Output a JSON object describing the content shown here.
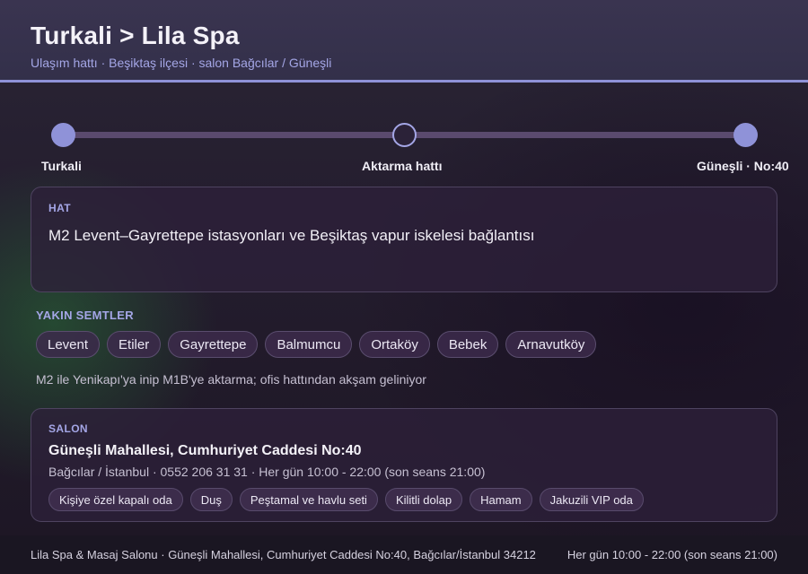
{
  "header": {
    "title": "Turkali > Lila Spa",
    "subtitle": "Ulaşım hattı · Beşiktaş ilçesi · salon Bağcılar / Güneşli"
  },
  "route": {
    "start": "Turkali",
    "middle": "Aktarma hattı",
    "end": "Güneşli · No:40"
  },
  "hat": {
    "label": "HAT",
    "text": "M2 Levent–Gayrettepe istasyonları ve Beşiktaş vapur iskelesi bağlantısı"
  },
  "nearby": {
    "label": "YAKIN SEMTLER",
    "items": [
      "Levent",
      "Etiler",
      "Gayrettepe",
      "Balmumcu",
      "Ortaköy",
      "Bebek",
      "Arnavutköy"
    ],
    "note": "M2 ile Yenikapı'ya inip M1B'ye aktarma; ofis hattından akşam geliniyor"
  },
  "salon": {
    "label": "SALON",
    "name": "Güneşli Mahallesi, Cumhuriyet Caddesi No:40",
    "meta": "Bağcılar / İstanbul · 0552 206 31 31 · Her gün 10:00 - 22:00 (son seans 21:00)",
    "amenities": [
      "Kişiye özel kapalı oda",
      "Duş",
      "Peştamal ve havlu seti",
      "Kilitli dolap",
      "Hamam",
      "Jakuzili VIP oda"
    ]
  },
  "footer": {
    "left": "Lila Spa & Masaj Salonu · Güneşli Mahallesi, Cumhuriyet Caddesi No:40, Bağcılar/İstanbul 34212",
    "right": "Her gün 10:00 - 22:00 (son seans 21:00)"
  },
  "colors": {
    "accent": "#8f92d8",
    "header_bg": "#3a3450",
    "card_bg": "#2d203a"
  }
}
